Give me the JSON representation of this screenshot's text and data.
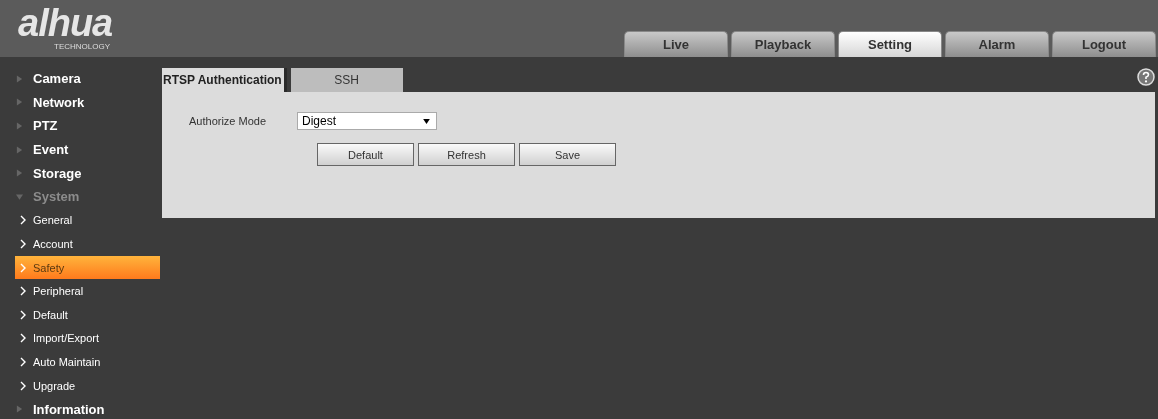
{
  "logo": {
    "wordmark": "alhua",
    "tagline": "TECHNOLOGY"
  },
  "top_tabs": [
    {
      "label": "Live",
      "selected": false
    },
    {
      "label": "Playback",
      "selected": false
    },
    {
      "label": "Setting",
      "selected": true
    },
    {
      "label": "Alarm",
      "selected": false
    },
    {
      "label": "Logout",
      "selected": false
    }
  ],
  "sidebar": {
    "items": [
      {
        "label": "Camera",
        "expanded": false
      },
      {
        "label": "Network",
        "expanded": false
      },
      {
        "label": "PTZ",
        "expanded": false
      },
      {
        "label": "Event",
        "expanded": false
      },
      {
        "label": "Storage",
        "expanded": false
      },
      {
        "label": "System",
        "expanded": true,
        "children": [
          {
            "label": "General",
            "selected": false
          },
          {
            "label": "Account",
            "selected": false
          },
          {
            "label": "Safety",
            "selected": true
          },
          {
            "label": "Peripheral",
            "selected": false
          },
          {
            "label": "Default",
            "selected": false
          },
          {
            "label": "Import/Export",
            "selected": false
          },
          {
            "label": "Auto Maintain",
            "selected": false
          },
          {
            "label": "Upgrade",
            "selected": false
          }
        ]
      },
      {
        "label": "Information",
        "expanded": false
      }
    ]
  },
  "sub_tabs": [
    {
      "label": "RTSP Authentication",
      "selected": true
    },
    {
      "label": "SSH",
      "selected": false
    }
  ],
  "form": {
    "label": "Authorize Mode",
    "value": "Digest"
  },
  "buttons": [
    "Default",
    "Refresh",
    "Save"
  ]
}
